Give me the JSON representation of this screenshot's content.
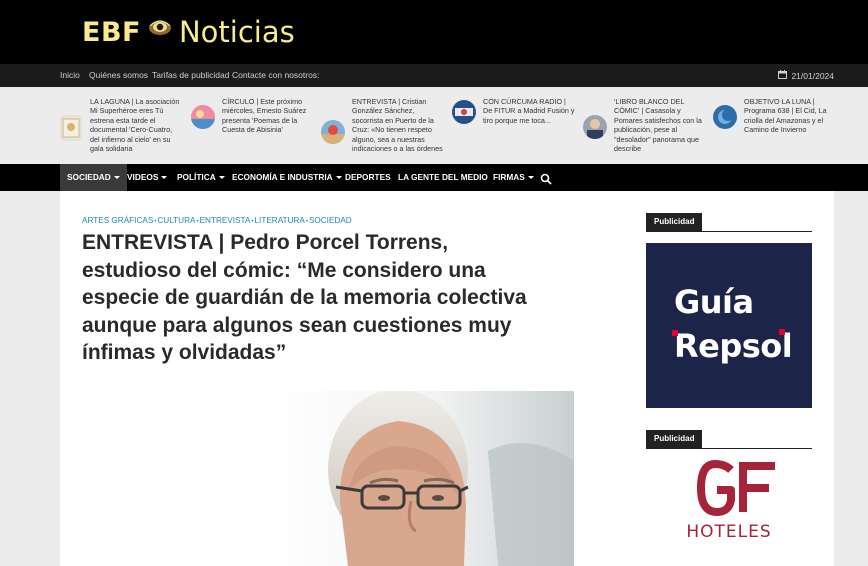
{
  "header": {
    "logo_ebf": "EBF",
    "logo_noticias": "Noticias",
    "logo_color": "#f7eb8c"
  },
  "topbar": {
    "links": [
      "Inicio",
      "Quiénes somos",
      "Tarifas de publicidad",
      "Contacte con nosotros:"
    ],
    "date": "21/01/2024",
    "date_icon": "calendar-icon"
  },
  "ticker": {
    "items": [
      {
        "text": "LA LAGUNA | La asociación Mi Superhéroe eres Tú estrena esta tarde el documental 'Cero-Cuatro, del infierno al cielo' en su gala solidaria",
        "thumb": "documentary-thumb"
      },
      {
        "text": "CÍRCULO | Este próximo miércoles, Ernesto Suárez presenta 'Poemas de la Cuesta de Abisinia'",
        "thumb": "poetry-thumb"
      },
      {
        "text": "ENTREVISTA | Cristian González Sánchez, socorrista en Puerto de la Cruz: «No tienen respeto alguno, sea a nuestras indicaciones o a las órdenes",
        "thumb": "beach-thumb"
      },
      {
        "text": "CON CÚRCUMA RADIO | De FITUR a Madrid Fusión y tiro porque me toca...",
        "thumb": "radio-thumb"
      },
      {
        "text": "'LIBRO BLANCO DEL CÓMIC' | Casasola y Pomares satisfechos con la publicación, pese al \"desolador\" panorama que describe",
        "thumb": "comic-thumb"
      },
      {
        "text": "OBJETIVO LA LUNA | Programa 638 | El Cid, La criolla del Amazonas y el Camino de Invierno",
        "thumb": "moon-thumb"
      }
    ]
  },
  "nav": {
    "items": [
      {
        "label": "SOCIEDAD",
        "dropdown": true,
        "active": true
      },
      {
        "label": "VIDEOS",
        "dropdown": true,
        "active": false
      },
      {
        "label": "POLÍTICA",
        "dropdown": true,
        "active": false
      },
      {
        "label": "ECONOMÍA E INDUSTRIA",
        "dropdown": true,
        "active": false
      },
      {
        "label": "DEPORTES",
        "dropdown": false,
        "active": false
      },
      {
        "label": "LA GENTE DEL MEDIO",
        "dropdown": false,
        "active": false
      },
      {
        "label": "FIRMAS",
        "dropdown": true,
        "active": false
      }
    ],
    "search_icon": "search-icon"
  },
  "article": {
    "categories": [
      "ARTES GRÁFICAS",
      "CULTURA",
      "ENTREVISTA",
      "LITERATURA",
      "SOCIEDAD"
    ],
    "category_color": "#1e88b8",
    "headline": "ENTREVISTA | Pedro Porcel Torrens, estudioso del cómic: “Me considero una especie de guardián de la memoria colectiva aunque para algunos sean cuestiones muy ínfimas y olvidadas”"
  },
  "sidebar": {
    "ads": [
      {
        "tag": "Publicidad",
        "brand_line1": "Guía",
        "brand_line2": "Repsol",
        "bg": "#1d2449",
        "accent": "#e4002b"
      },
      {
        "tag": "Publicidad",
        "logo_letters": "GF",
        "brand": "HOTELES",
        "color": "#a5243a"
      }
    ]
  }
}
